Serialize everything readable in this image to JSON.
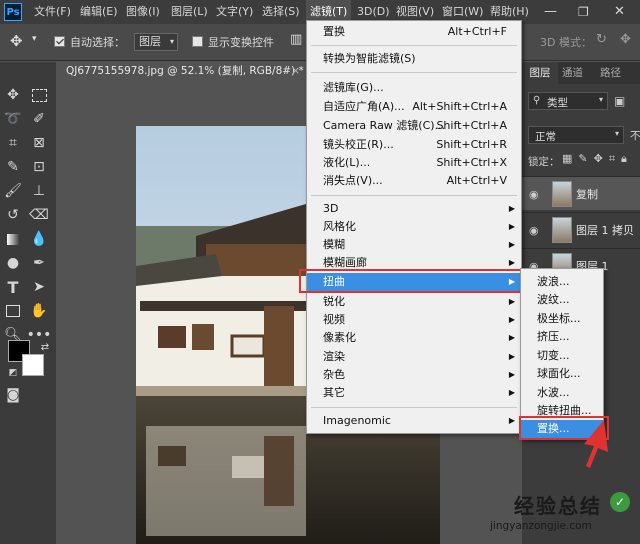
{
  "menubar": {
    "logo": "Ps",
    "items": [
      "文件(F)",
      "编辑(E)",
      "图像(I)",
      "图层(L)",
      "文字(Y)",
      "选择(S)",
      "滤镜(T)",
      "3D(D)",
      "视图(V)",
      "窗口(W)",
      "帮助(H)"
    ],
    "active": "滤镜(T)"
  },
  "options_bar": {
    "auto_select_label": "自动选择：",
    "auto_select_value": "图层",
    "show_transform_label": "显示变换控件",
    "mode_3d_label": "3D 模式："
  },
  "document_tab": {
    "title": "QJ6775155978.jpg @ 52.1% (复制, RGB/8#) *",
    "close": "×"
  },
  "filter_menu": {
    "items": [
      {
        "label": "置换",
        "shortcut": "Alt+Ctrl+F"
      },
      {
        "label": "转换为智能滤镜(S)",
        "shortcut": ""
      },
      {
        "label": "滤镜库(G)...",
        "shortcut": ""
      },
      {
        "label": "自适应广角(A)...",
        "shortcut": "Alt+Shift+Ctrl+A"
      },
      {
        "label": "Camera Raw 滤镜(C)...",
        "shortcut": "Shift+Ctrl+A"
      },
      {
        "label": "镜头校正(R)...",
        "shortcut": "Shift+Ctrl+R"
      },
      {
        "label": "液化(L)...",
        "shortcut": "Shift+Ctrl+X"
      },
      {
        "label": "消失点(V)...",
        "shortcut": "Alt+Ctrl+V"
      },
      {
        "label": "3D",
        "submenu": true
      },
      {
        "label": "风格化",
        "submenu": true
      },
      {
        "label": "模糊",
        "submenu": true
      },
      {
        "label": "模糊画廊",
        "submenu": true
      },
      {
        "label": "扭曲",
        "submenu": true
      },
      {
        "label": "锐化",
        "submenu": true
      },
      {
        "label": "视频",
        "submenu": true
      },
      {
        "label": "像素化",
        "submenu": true
      },
      {
        "label": "渲染",
        "submenu": true
      },
      {
        "label": "杂色",
        "submenu": true
      },
      {
        "label": "其它",
        "submenu": true
      },
      {
        "label": "Imagenomic",
        "submenu": true
      }
    ],
    "highlighted": "扭曲"
  },
  "distort_submenu": {
    "items": [
      "波浪...",
      "波纹...",
      "极坐标...",
      "挤压...",
      "切变...",
      "球面化...",
      "水波...",
      "旋转扭曲...",
      "置换..."
    ],
    "highlighted": "置换..."
  },
  "layers_panel": {
    "tabs": [
      "图层",
      "通道",
      "路径"
    ],
    "kind_label": "类型",
    "blend_mode": "正常",
    "opacity_prefix": "不",
    "lock_label": "锁定：",
    "layers": [
      {
        "name": "复制",
        "selected": true
      },
      {
        "name": "图层 1 拷贝",
        "selected": false
      },
      {
        "name": "图层 1",
        "selected": false
      }
    ]
  },
  "watermark": {
    "top": "经验总结",
    "bottom": "jingyanzongjie.com"
  },
  "colors": {
    "highlight": "#3b8fe3",
    "annotation": "#e03232"
  }
}
